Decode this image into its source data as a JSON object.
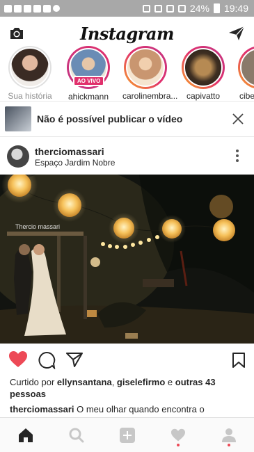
{
  "status_bar": {
    "battery": "24%",
    "time": "19:49"
  },
  "header": {
    "logo": "Instagram",
    "camera_icon": "camera-icon",
    "direct_icon": "paper-plane-icon"
  },
  "stories": [
    {
      "name": "Sua história",
      "muted": true
    },
    {
      "name": "ahickmann",
      "badge": "AO VIVO"
    },
    {
      "name": "carolinembra..."
    },
    {
      "name": "capivatto"
    },
    {
      "name": "cibe"
    }
  ],
  "notice": {
    "text": "Não é possível publicar o vídeo",
    "close_icon": "close-icon"
  },
  "post": {
    "username": "therciomassari",
    "location": "Espaço Jardim Nobre",
    "watermark": "Thercio massari",
    "liked": true,
    "likes_prefix": "Curtido por ",
    "liker1": "ellynsantana",
    "sep": ", ",
    "liker2": "giselefirmo",
    "conj": " e ",
    "others": "outras 43 pessoas",
    "caption_user": "therciomassari",
    "caption_text": " O meu olhar quando encontra o"
  },
  "colors": {
    "like": "#ed4956",
    "status_bar": "#a8a8a8"
  }
}
